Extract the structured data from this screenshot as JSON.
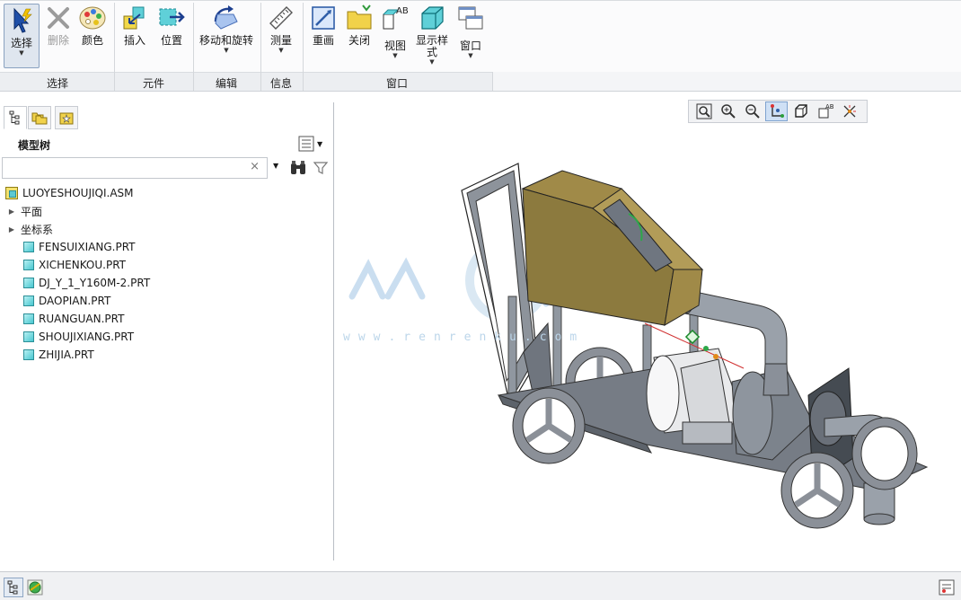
{
  "ribbon": {
    "buttons": {
      "select": "选择",
      "delete": "删除",
      "color": "颜色",
      "insert": "插入",
      "position": "位置",
      "move_rotate": "移动和旋转",
      "measure": "测量",
      "redraw": "重画",
      "close": "关闭",
      "view": "视图",
      "display_style": "显示样\n式",
      "window": "窗口"
    },
    "groups": {
      "select": "选择",
      "component": "元件",
      "edit": "编辑",
      "info": "信息",
      "window": "窗口"
    }
  },
  "panel": {
    "title": "模型树",
    "search": {
      "value": "",
      "clear": "×"
    },
    "tree": {
      "root": "LUOYESHOUJIQI.ASM",
      "planes": "平面",
      "csys": "坐标系",
      "parts": [
        "FENSUIXIANG.PRT",
        "XICHENKOU.PRT",
        "DJ_Y_1_Y160M-2.PRT",
        "DAOPIAN.PRT",
        "RUANGUAN.PRT",
        "SHOUJIXIANG.PRT",
        "ZHIJIA.PRT"
      ]
    }
  },
  "graphics": {
    "watermark": {
      "text": "www.renrenku.com"
    }
  },
  "colors": {
    "hopper": "#8c7a3e",
    "frame": "#7d838c",
    "pipe": "#9aa1aa",
    "accent": "#3f7fd0"
  }
}
